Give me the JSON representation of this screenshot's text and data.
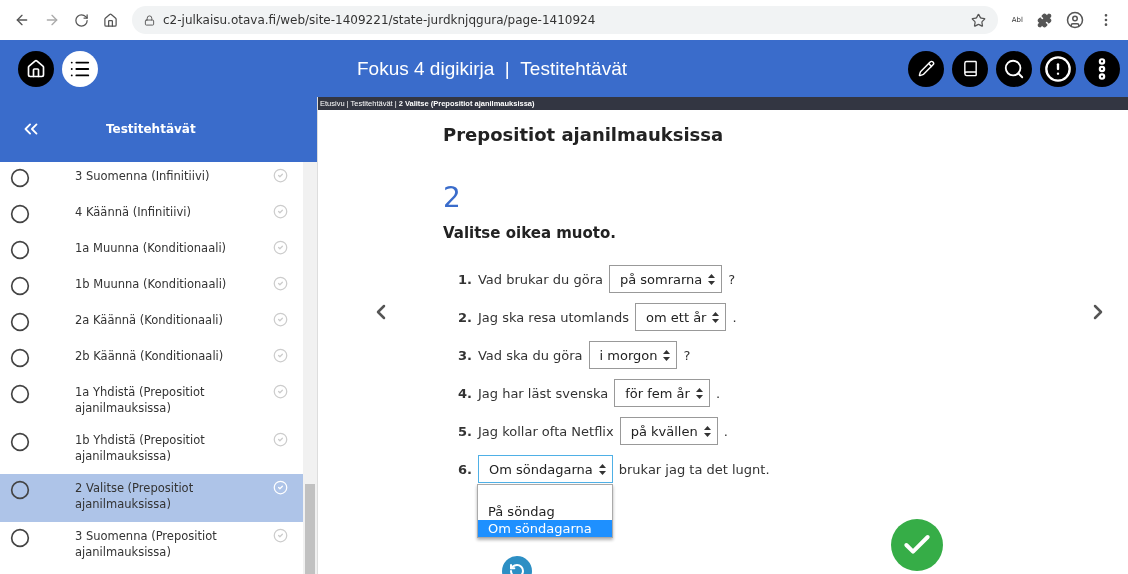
{
  "browser": {
    "url": "c2-julkaisu.otava.fi/web/site-1409221/state-jurdknjqgura/page-1410924",
    "extension_label": "Abl"
  },
  "header": {
    "title": "Fokus 4 digikirja",
    "separator": "|",
    "section": "Testitehtävät"
  },
  "sidebar": {
    "title": "Testitehtävät",
    "items": [
      {
        "label": "3 Suomenna (Infinitiivi)",
        "selected": false
      },
      {
        "label": "4 Käännä (Infinitiivi)",
        "selected": false
      },
      {
        "label": "1a Muunna (Konditionaali)",
        "selected": false
      },
      {
        "label": "1b Muunna (Konditionaali)",
        "selected": false
      },
      {
        "label": "2a Käännä (Konditionaali)",
        "selected": false
      },
      {
        "label": "2b Käännä (Konditionaali)",
        "selected": false
      },
      {
        "label": "1a Yhdistä (Prepositiot ajanilmauksissa)",
        "selected": false
      },
      {
        "label": "1b Yhdistä (Prepositiot ajanilmauksissa)",
        "selected": false
      },
      {
        "label": "2 Valitse (Prepositiot ajanilmauksissa)",
        "selected": true
      },
      {
        "label": "3 Suomenna (Prepositiot ajanilmauksissa)",
        "selected": false
      }
    ]
  },
  "breadcrumb": [
    {
      "label": "Etusivu",
      "current": false
    },
    {
      "label": "Testitehtävät",
      "current": false
    },
    {
      "label": "2 Valitse (Prepositiot ajanilmauksissa)",
      "current": true
    }
  ],
  "breadcrumb_separator": "|",
  "page_title": "Prepositiot ajanilmauksissa",
  "exercise_number": "2",
  "instruction": "Valitse oikea muoto.",
  "questions": [
    {
      "number": "1.",
      "before": "Vad brukar du göra",
      "choice": "på somrarna",
      "after": "?",
      "focused": false
    },
    {
      "number": "2.",
      "before": "Jag ska resa utomlands",
      "choice": "om ett år",
      "after": ".",
      "focused": false
    },
    {
      "number": "3.",
      "before": "Vad ska du göra",
      "choice": "i morgon",
      "after": "?",
      "focused": false
    },
    {
      "number": "4.",
      "before": "Jag har läst svenska",
      "choice": "för fem år",
      "after": ".",
      "focused": false
    },
    {
      "number": "5.",
      "before": "Jag kollar ofta Netflix",
      "choice": "på kvällen",
      "after": ".",
      "focused": false
    },
    {
      "number": "6.",
      "choice": "Om söndagarna",
      "after": "brukar jag ta det lugnt.",
      "focused": true,
      "options": [
        {
          "label": "På söndag",
          "selected": false
        },
        {
          "label": "Om söndagarna",
          "selected": true
        }
      ]
    }
  ]
}
